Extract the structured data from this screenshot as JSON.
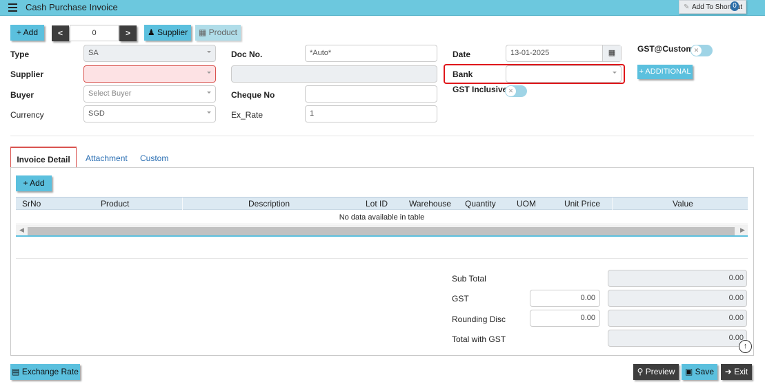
{
  "header": {
    "title": "Cash Purchase Invoice",
    "shortcut_label": "Add To ShortCut",
    "shortcut_count": "0"
  },
  "toolbar": {
    "add": "+ Add",
    "nav_prev": "<",
    "nav_value": "0",
    "nav_next": ">",
    "supplier": "Supplier",
    "product": "Product"
  },
  "form": {
    "type_label": "Type",
    "type_value": "SA",
    "supplier_label": "Supplier",
    "supplier_value": "",
    "buyer_label": "Buyer",
    "buyer_placeholder": "Select Buyer",
    "currency_label": "Currency",
    "currency_value": "SGD",
    "docno_label": "Doc No.",
    "docno_value": "*Auto*",
    "cheque_label": "Cheque No",
    "cheque_value": "",
    "exrate_label": "Ex_Rate",
    "exrate_value": "1",
    "date_label": "Date",
    "date_value": "13-01-2025",
    "bank_label": "Bank",
    "bank_value": "",
    "gst_inclusive_label": "GST Inclusive",
    "gst_custom_label": "GST@Custom",
    "additional_button": "+ ADDITIONAL"
  },
  "tabs": [
    {
      "label": "Invoice Detail",
      "active": true
    },
    {
      "label": "Attachment",
      "active": false
    },
    {
      "label": "Custom",
      "active": false
    }
  ],
  "detail": {
    "add_button": "+ Add",
    "columns": [
      "SrNo",
      "Product",
      "Description",
      "Lot ID",
      "Warehouse",
      "Quantity",
      "UOM",
      "Unit Price",
      "Value"
    ],
    "empty_message": "No data available in table"
  },
  "totals": {
    "sub_total_label": "Sub Total",
    "sub_total": "0.00",
    "gst_label": "GST",
    "gst_input": "0.00",
    "gst_total": "0.00",
    "rounding_label": "Rounding Disc",
    "rounding_input": "0.00",
    "rounding_total": "0.00",
    "total_gst_label": "Total with GST",
    "total_gst": "0.00"
  },
  "footer": {
    "exchange_rate": "Exchange Rate",
    "preview": "Preview",
    "save": "Save",
    "exit": "Exit"
  },
  "colors": {
    "accent": "#5bc0de",
    "header": "#6cc8de",
    "dark_button": "#3d3d3d",
    "error": "#d9534f",
    "highlight": "#e0161a"
  }
}
